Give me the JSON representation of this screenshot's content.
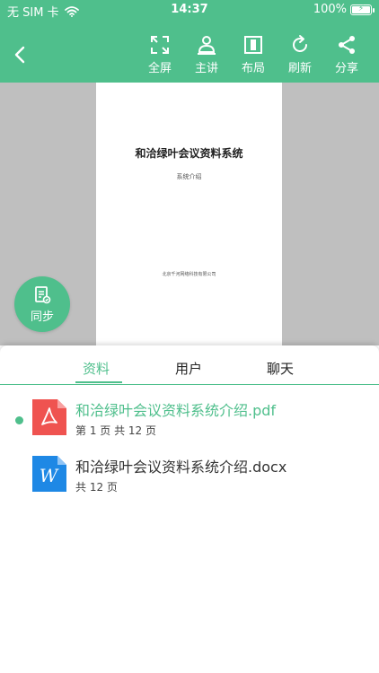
{
  "status_bar": {
    "carrier": "无 SIM 卡",
    "time": "14:37",
    "battery": "100%",
    "battery_level": 1.0
  },
  "toolbar": {
    "items": [
      {
        "label": "全屏",
        "icon": "fullscreen-icon"
      },
      {
        "label": "主讲",
        "icon": "presenter-icon"
      },
      {
        "label": "布局",
        "icon": "layout-icon"
      },
      {
        "label": "刷新",
        "icon": "refresh-icon"
      },
      {
        "label": "分享",
        "icon": "share-icon"
      }
    ]
  },
  "document": {
    "title": "和洽绿叶会议资料系统",
    "subtitle": "系统介绍",
    "footer": "北京千河网络科技有限公司"
  },
  "sync": {
    "label": "同步"
  },
  "tabs": [
    {
      "label": "资料",
      "active": true
    },
    {
      "label": "用户",
      "active": false
    },
    {
      "label": "聊天",
      "active": false
    }
  ],
  "files": [
    {
      "name": "和洽绿叶会议资料系统介绍.pdf",
      "meta": "第 1 页    共 12 页",
      "type": "pdf",
      "active": true
    },
    {
      "name": "和洽绿叶会议资料系统介绍.docx",
      "meta": "共 12 页",
      "type": "docx",
      "active": false
    }
  ],
  "colors": {
    "accent": "#4fbf8c",
    "pdf": "#ef5350",
    "word": "#1e88e5",
    "viewer_bg": "#bfbfbf"
  }
}
